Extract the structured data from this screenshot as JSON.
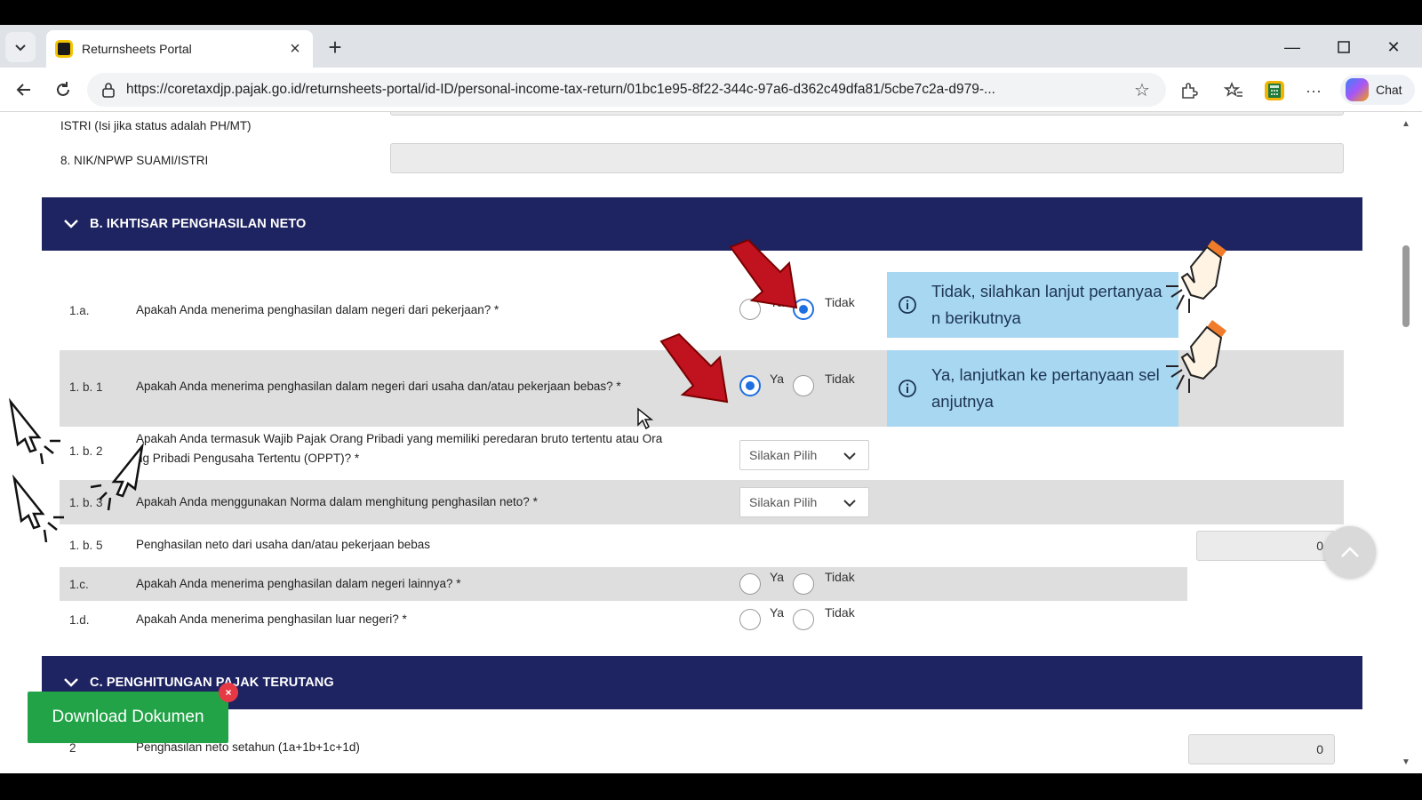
{
  "browser": {
    "tab_title": "Returnsheets Portal",
    "url": "https://coretaxdjp.pajak.go.id/returnsheets-portal/id-ID/personal-income-tax-return/01bc1e95-8f22-344c-97a6-d362c49dfa81/5cbe7c2a-d979-...",
    "chat_label": "Chat"
  },
  "form_top": {
    "istri_label": "ISTRI (Isi jika status adalah PH/MT)",
    "nik_label": "8. NIK/NPWP SUAMI/ISTRI"
  },
  "section_b": {
    "title": "B. IKHTISAR PENGHASILAN NETO",
    "q1a": {
      "num": "1.a.",
      "text": "Apakah Anda menerima penghasilan dalam negeri dari pekerjaan? *",
      "selected": "Tidak"
    },
    "q1b1": {
      "num": "1. b. 1",
      "text": "Apakah Anda menerima penghasilan dalam negeri dari usaha dan/atau pekerjaan bebas? *",
      "selected": "Ya"
    },
    "q1b2": {
      "num": "1. b. 2",
      "text_line1": "Apakah Anda termasuk Wajib Pajak Orang Pribadi yang memiliki peredaran bruto tertentu atau Ora",
      "text_line2": "ng Pribadi Pengusaha Tertentu (OPPT)? *",
      "select_value": "Silakan Pilih"
    },
    "q1b3": {
      "num": "1. b. 3",
      "text": "Apakah Anda menggunakan Norma dalam menghitung penghasilan neto? *",
      "select_value": "Silakan Pilih"
    },
    "q1b5": {
      "num": "1. b. 5",
      "text": "Penghasilan neto dari usaha dan/atau pekerjaan bebas",
      "value": "0"
    },
    "q1c": {
      "num": "1.c.",
      "text": "Apakah Anda menerima penghasilan dalam negeri lainnya? *"
    },
    "q1d": {
      "num": "1.d.",
      "text": "Apakah Anda menerima penghasilan luar negeri? *"
    },
    "radio_yes": "Ya",
    "radio_no": "Tidak"
  },
  "info_boxes": {
    "tidak_line1": "Tidak, silahkan lanjut pertanyaa",
    "tidak_line2": "n berikutnya",
    "ya_line1": "Ya, lanjutkan ke pertanyaan sel",
    "ya_line2": "anjutnya"
  },
  "section_c": {
    "title": "C. PENGHITUNGAN PAJAK TERUTANG",
    "q2": {
      "num": "2",
      "text": "Penghasilan neto setahun (1a+1b+1c+1d)",
      "value": "0"
    }
  },
  "download": {
    "label": "Download Dokumen",
    "close": "×"
  },
  "colors": {
    "navy": "#1e2361",
    "radio_blue": "#1e6fe0",
    "info_bg": "#a8d7f2",
    "download_green": "#22a347",
    "arrow_red": "#c1121f"
  }
}
